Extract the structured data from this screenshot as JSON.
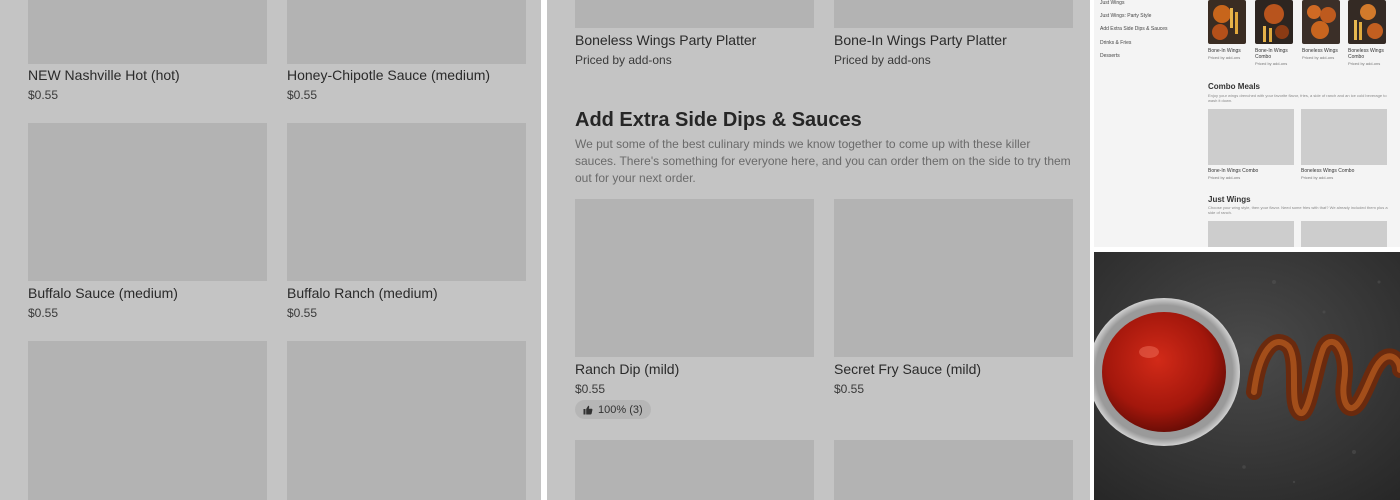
{
  "left_panel": {
    "items": [
      {
        "name": "NEW Nashville Hot (hot)",
        "price": "$0.55"
      },
      {
        "name": "Honey-Chipotle Sauce (medium)",
        "price": "$0.55"
      },
      {
        "name": "Buffalo Sauce (medium)",
        "price": "$0.55"
      },
      {
        "name": "Buffalo Ranch (medium)",
        "price": "$0.55"
      }
    ]
  },
  "mid_panel": {
    "top_items": [
      {
        "name": "Boneless Wings Party Platter",
        "price": "Priced by add-ons"
      },
      {
        "name": "Bone-In Wings Party Platter",
        "price": "Priced by add-ons"
      }
    ],
    "section_title": "Add Extra Side Dips & Sauces",
    "section_desc": "We put some of the best culinary minds we know together to come up with these killer sauces. There's something for everyone here, and you can order them on the side to try them out for your next order.",
    "items": [
      {
        "name": "Ranch Dip (mild)",
        "price": "$0.55",
        "rating": "100% (3)"
      },
      {
        "name": "Secret Fry Sauce (mild)",
        "price": "$0.55"
      }
    ]
  },
  "mini_page": {
    "sidebar": [
      "Just Wings",
      "Just Wings: Party Style",
      "Add Extra Side Dips & Sauces",
      "Drinks & Fries",
      "Desserts"
    ],
    "thumbs": [
      {
        "label": "Bone-In Wings",
        "sub": "Priced by add-ons"
      },
      {
        "label": "Bone-In Wings Combo",
        "sub": "Priced by add-ons"
      },
      {
        "label": "Boneless Wings",
        "sub": "Priced by add-ons"
      },
      {
        "label": "Boneless Wings Combo",
        "sub": "Priced by add-ons"
      }
    ],
    "combo_title": "Combo Meals",
    "combo_desc": "Enjoy your wings drenched with your favorite flavor, fries, a side of ranch and an ice cold beverage to wash it down.",
    "combo_items": [
      {
        "label": "Bone-In Wings Combo",
        "sub": "Priced by add-ons"
      },
      {
        "label": "Boneless Wings Combo",
        "sub": "Priced by add-ons"
      }
    ],
    "just_title": "Just Wings",
    "just_desc": "Choose your wing style, then your flavor. Need some fries with that? We already included them plus a side of ranch."
  },
  "colors": {
    "overlay_gray": "#c4c4c4",
    "placeholder": "#b3b3b3",
    "sauce_red": "#b0180e",
    "slate": "#2f2f2f"
  }
}
